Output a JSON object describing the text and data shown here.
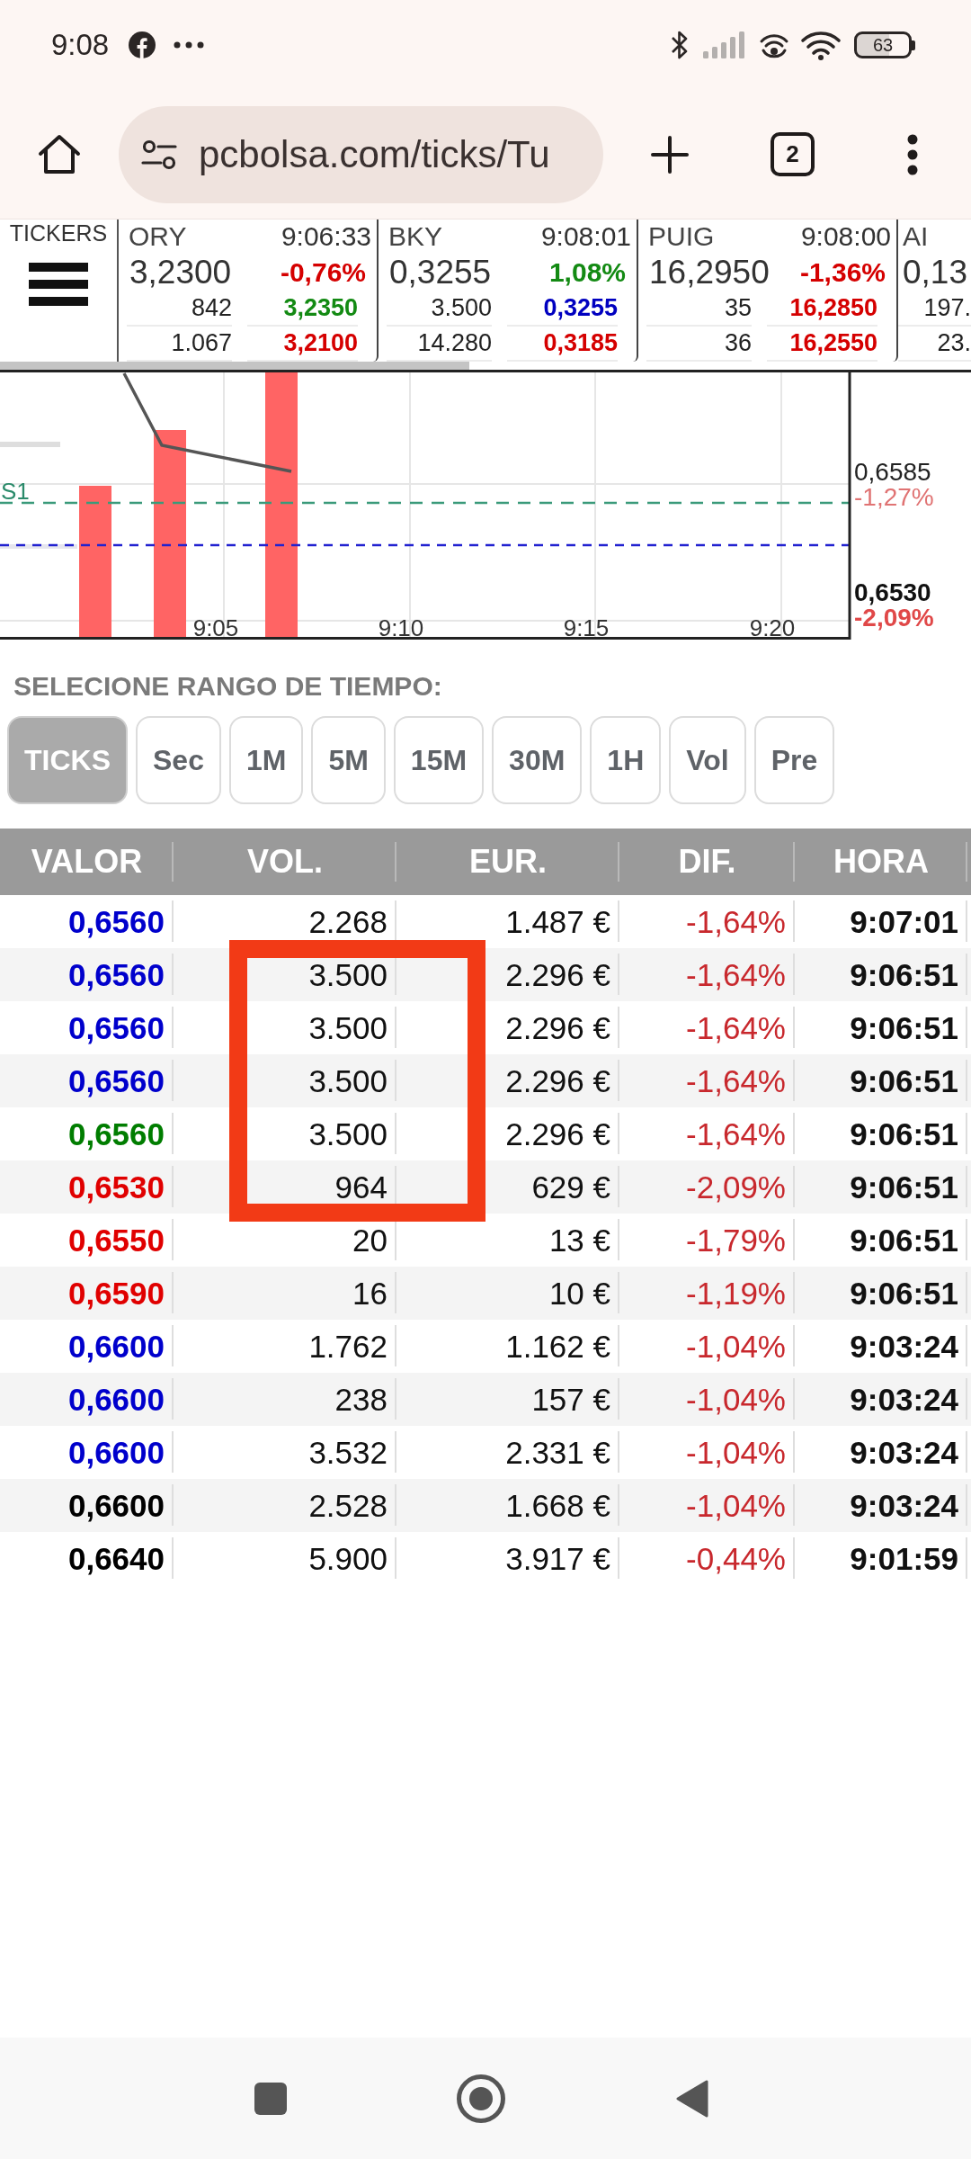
{
  "status_bar": {
    "time": "9:08",
    "battery": "63"
  },
  "browser": {
    "url": "pcbolsa.com/ticks/Tu",
    "tab_count": "2"
  },
  "ticker_strip": {
    "label": "TICKERS",
    "tickers": [
      {
        "name": "ORY",
        "time": "9:06:33",
        "price": "3,2300",
        "change": {
          "text": "-0,76%",
          "color": "#d50000"
        },
        "levels": [
          {
            "volume": "842",
            "price": "3,2350",
            "color": "#138a13"
          },
          {
            "volume": "1.067",
            "price": "3,2100",
            "color": "#d50000"
          }
        ]
      },
      {
        "name": "BKY",
        "time": "9:08:01",
        "price": "0,3255",
        "change": {
          "text": "1,08%",
          "color": "#138a13"
        },
        "levels": [
          {
            "volume": "3.500",
            "price": "0,3255",
            "color": "#0000c0"
          },
          {
            "volume": "14.280",
            "price": "0,3185",
            "color": "#d50000"
          }
        ]
      },
      {
        "name": "PUIG",
        "time": "9:08:00",
        "price": "16,2950",
        "change": {
          "text": "-1,36%",
          "color": "#d50000"
        },
        "levels": [
          {
            "volume": "35",
            "price": "16,2850",
            "color": "#d50000"
          },
          {
            "volume": "36",
            "price": "16,2550",
            "color": "#d50000"
          }
        ]
      },
      {
        "name": "AI",
        "price": "0,13",
        "levels": [
          {
            "volume": "197."
          },
          {
            "volume": "23."
          }
        ]
      }
    ]
  },
  "chart": {
    "support_label": "S1",
    "x_labels": [
      "9:05",
      "9:10",
      "9:15",
      "9:20"
    ],
    "price_labels": [
      {
        "kind": "level",
        "price": "0,6585",
        "change": "-1,27%"
      },
      {
        "kind": "current",
        "price": "0,6530",
        "change": "-2,09%"
      }
    ]
  },
  "time_range": {
    "title": "SELECIONE RANGO DE TIEMPO:",
    "options": [
      {
        "label": "TICKS",
        "selected": true
      },
      {
        "label": "Sec",
        "selected": false
      },
      {
        "label": "1M",
        "selected": false
      },
      {
        "label": "5M",
        "selected": false
      },
      {
        "label": "15M",
        "selected": false
      },
      {
        "label": "30M",
        "selected": false
      },
      {
        "label": "1H",
        "selected": false
      },
      {
        "label": "Vol",
        "selected": false
      },
      {
        "label": "Pre",
        "selected": false
      }
    ]
  },
  "table": {
    "columns": [
      "VALOR",
      "VOL.",
      "EUR.",
      "DIF.",
      "HORA"
    ],
    "rows": [
      {
        "valor": "0,6560",
        "color": "#0000cc",
        "vol": "2.268",
        "eur": "1.487 €",
        "dif": "-1,64%",
        "hora": "9:07:01"
      },
      {
        "valor": "0,6560",
        "color": "#0000cc",
        "vol": "3.500",
        "eur": "2.296 €",
        "dif": "-1,64%",
        "hora": "9:06:51"
      },
      {
        "valor": "0,6560",
        "color": "#0000cc",
        "vol": "3.500",
        "eur": "2.296 €",
        "dif": "-1,64%",
        "hora": "9:06:51"
      },
      {
        "valor": "0,6560",
        "color": "#0000cc",
        "vol": "3.500",
        "eur": "2.296 €",
        "dif": "-1,64%",
        "hora": "9:06:51"
      },
      {
        "valor": "0,6560",
        "color": "#007d00",
        "vol": "3.500",
        "eur": "2.296 €",
        "dif": "-1,64%",
        "hora": "9:06:51"
      },
      {
        "valor": "0,6530",
        "color": "#e00000",
        "vol": "964",
        "eur": "629 €",
        "dif": "-2,09%",
        "hora": "9:06:51"
      },
      {
        "valor": "0,6550",
        "color": "#e00000",
        "vol": "20",
        "eur": "13 €",
        "dif": "-1,79%",
        "hora": "9:06:51"
      },
      {
        "valor": "0,6590",
        "color": "#e00000",
        "vol": "16",
        "eur": "10 €",
        "dif": "-1,19%",
        "hora": "9:06:51"
      },
      {
        "valor": "0,6600",
        "color": "#0000cc",
        "vol": "1.762",
        "eur": "1.162 €",
        "dif": "-1,04%",
        "hora": "9:03:24"
      },
      {
        "valor": "0,6600",
        "color": "#0000cc",
        "vol": "238",
        "eur": "157 €",
        "dif": "-1,04%",
        "hora": "9:03:24"
      },
      {
        "valor": "0,6600",
        "color": "#0000cc",
        "vol": "3.532",
        "eur": "2.331 €",
        "dif": "-1,04%",
        "hora": "9:03:24"
      },
      {
        "valor": "0,6600",
        "color": "#000000",
        "vol": "2.528",
        "eur": "1.668 €",
        "dif": "-1,04%",
        "hora": "9:03:24"
      },
      {
        "valor": "0,6640",
        "color": "#000000",
        "vol": "5.900",
        "eur": "3.917 €",
        "dif": "-0,44%",
        "hora": "9:01:59"
      }
    ]
  }
}
